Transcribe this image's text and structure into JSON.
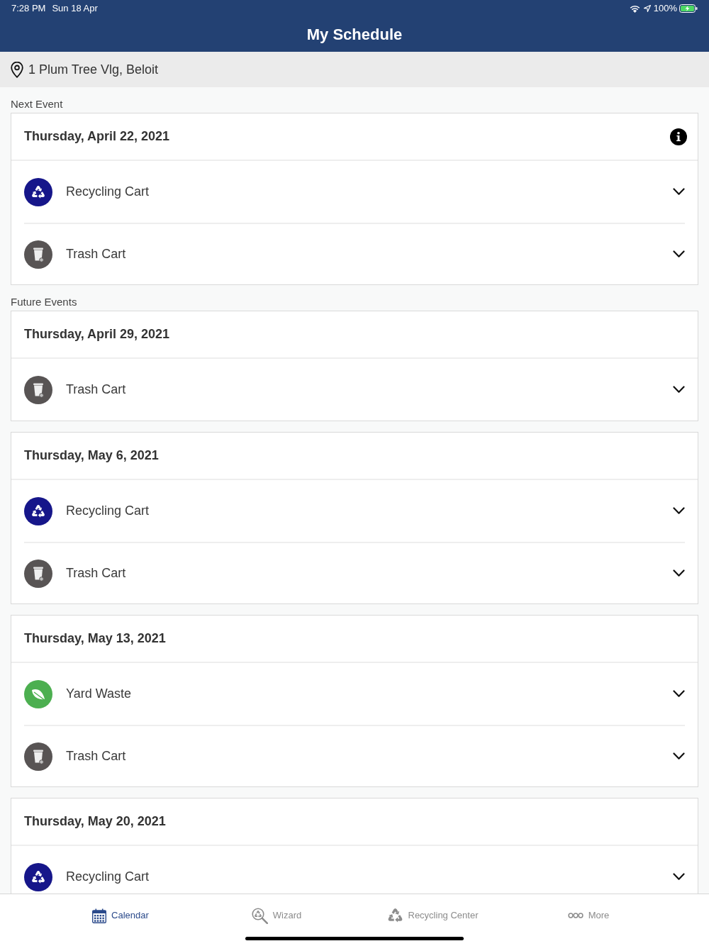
{
  "status_bar": {
    "time": "7:28 PM",
    "date": "Sun 18 Apr",
    "battery": "100%"
  },
  "header": {
    "title": "My Schedule"
  },
  "address": {
    "text": "1 Plum Tree Vlg, Beloit"
  },
  "sections": [
    {
      "label": "Next Event",
      "events": [
        {
          "date": "Thursday, April 22, 2021",
          "info": true,
          "items": [
            {
              "kind": "recycling",
              "label": "Recycling Cart",
              "expanded": false
            },
            {
              "kind": "trash",
              "label": "Trash Cart",
              "expanded": false
            }
          ]
        }
      ]
    },
    {
      "label": "Future Events",
      "events": [
        {
          "date": "Thursday, April 29, 2021",
          "info": false,
          "items": [
            {
              "kind": "trash",
              "label": "Trash Cart",
              "expanded": false
            }
          ]
        },
        {
          "date": "Thursday, May 6, 2021",
          "info": false,
          "items": [
            {
              "kind": "recycling",
              "label": "Recycling Cart",
              "expanded": false
            },
            {
              "kind": "trash",
              "label": "Trash Cart",
              "expanded": false
            }
          ]
        },
        {
          "date": "Thursday, May 13, 2021",
          "info": false,
          "items": [
            {
              "kind": "yard",
              "label": "Yard Waste",
              "expanded": false
            },
            {
              "kind": "trash",
              "label": "Trash Cart",
              "expanded": false
            }
          ]
        },
        {
          "date": "Thursday, May 20, 2021",
          "info": false,
          "items": [
            {
              "kind": "recycling",
              "label": "Recycling Cart",
              "expanded": false
            }
          ]
        }
      ]
    }
  ],
  "tab_bar": [
    {
      "kind": "calendar",
      "label": "Calendar",
      "selected": true
    },
    {
      "kind": "wizard",
      "label": "Wizard",
      "selected": false
    },
    {
      "kind": "recycling",
      "label": "Recycling Center",
      "selected": false
    },
    {
      "kind": "more",
      "label": "More",
      "selected": false
    }
  ]
}
